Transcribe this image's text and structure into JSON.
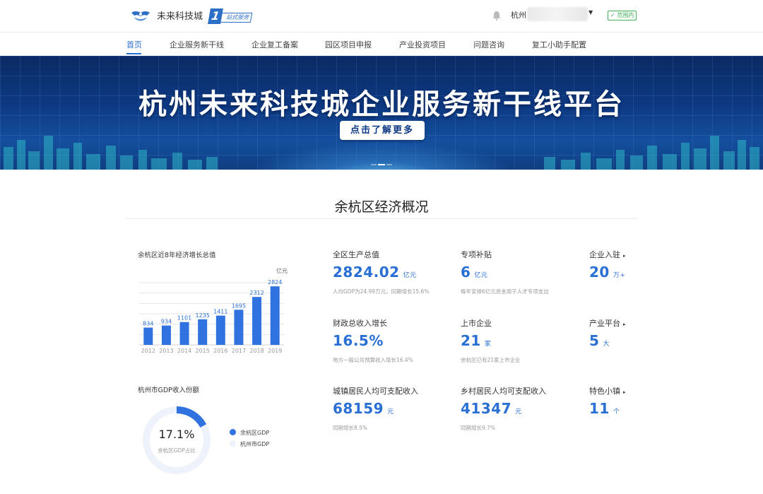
{
  "header": {
    "site_name": "未来科技城",
    "badge_number": "1",
    "badge_text": "站式服务",
    "city": "杭州",
    "range_badge": "✓ 范围内",
    "bell_icon": "bell-icon",
    "caret_icon": "caret-down-icon"
  },
  "nav": {
    "items": [
      "首页",
      "企业服务新干线",
      "企业复工备案",
      "园区项目申报",
      "产业投资项目",
      "问题咨询",
      "复工小助手配置"
    ],
    "active_index": 0,
    "active_color": "#2a6fd4"
  },
  "banner": {
    "title": "杭州未来科技城企业服务新干线平台",
    "button": "点击了解更多"
  },
  "section": {
    "title": "余杭区经济概况"
  },
  "chart_data": [
    {
      "type": "bar",
      "title": "余杭区近8年经济增长总值",
      "unit_label": "亿元",
      "categories": [
        "2012",
        "2013",
        "2014",
        "2015",
        "2016",
        "2017",
        "2018",
        "2019"
      ],
      "values": [
        834,
        934,
        1101,
        1235,
        1411,
        1695,
        2312,
        2824
      ],
      "ylim": [
        0,
        3000
      ],
      "grid": true,
      "bar_color": "#2f72e0"
    },
    {
      "type": "pie",
      "title": "杭州市GDP收入份额",
      "center_value": "17.1%",
      "center_caption": "余杭区GDP占比",
      "slices": [
        {
          "name": "余杭区GDP",
          "value": 17.1,
          "color": "#2f72e0"
        },
        {
          "name": "杭州市GDP",
          "value": 82.9,
          "color": "#eef3fb"
        }
      ]
    }
  ],
  "stats": {
    "gdp": {
      "label": "全区生产总值",
      "value": "2824.02",
      "unit": "亿元",
      "note": "人均GDP为24.99万元，同期增长15.6%"
    },
    "subsidy": {
      "label": "专项补贴",
      "value": "6",
      "unit": "亿元",
      "note": "每年安排6亿元资金用于人才专项支出"
    },
    "enterprises": {
      "label": "企业入驻",
      "value": "20",
      "unit": "万+"
    },
    "revenue": {
      "label": "财政总收入增长",
      "value": "16.5%",
      "note": "地方一般公共预算收入增长16.4%"
    },
    "listed": {
      "label": "上市企业",
      "value": "21",
      "unit": "家",
      "note": "余杭区已有21家上市企业"
    },
    "platform": {
      "label": "产业平台",
      "value": "5",
      "unit": "大"
    },
    "urban_income": {
      "label": "城镇居民人均可支配收入",
      "value": "68159",
      "unit": "元",
      "note": "同期增长8.5%"
    },
    "rural_income": {
      "label": "乡村居民人均可支配收入",
      "value": "41347",
      "unit": "元",
      "note": "同期增长9.7%"
    },
    "towns": {
      "label": "特色小镇",
      "value": "11",
      "unit": "个"
    },
    "arrow_icon": "▸"
  }
}
